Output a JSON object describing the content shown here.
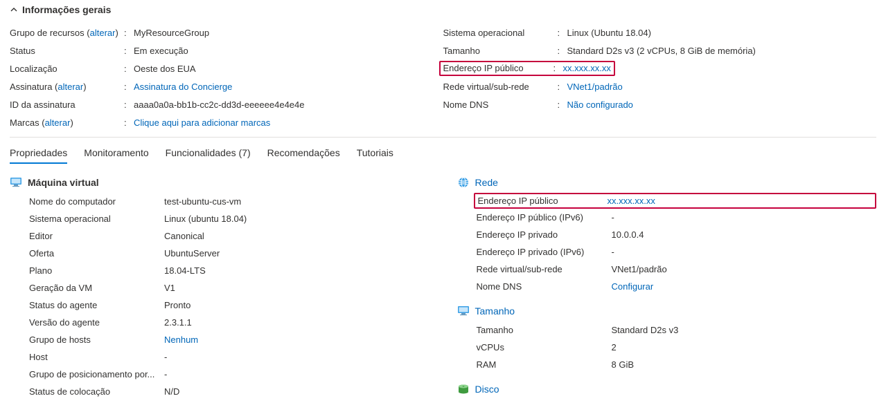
{
  "section_title": "Informações gerais",
  "change_label": "alterar",
  "left_essentials": {
    "resource_group": {
      "label": "Grupo de recursos",
      "value": "MyResourceGroup"
    },
    "status": {
      "label": "Status",
      "value": "Em execução"
    },
    "location": {
      "label": "Localização",
      "value": "Oeste dos EUA"
    },
    "subscription": {
      "label": "Assinatura",
      "value": "Assinatura do Concierge"
    },
    "subscription_id": {
      "label": "ID da assinatura",
      "value": "aaaa0a0a-bb1b-cc2c-dd3d-eeeeee4e4e4e"
    },
    "tags": {
      "label": "Marcas",
      "value": "Clique aqui para adicionar marcas"
    }
  },
  "right_essentials": {
    "os": {
      "label": "Sistema operacional",
      "value": "Linux (Ubuntu 18.04)"
    },
    "size": {
      "label": "Tamanho",
      "value": "Standard D2s v3 (2 vCPUs, 8 GiB de memória)"
    },
    "public_ip": {
      "label": "Endereço IP público",
      "value": "xx.xxx.xx.xx"
    },
    "vnet": {
      "label": "Rede virtual/sub-rede",
      "value": "VNet1/padrão"
    },
    "dns": {
      "label": "Nome DNS",
      "value": "Não configurado"
    }
  },
  "tabs": {
    "properties": "Propriedades",
    "monitoring": "Monitoramento",
    "capabilities": "Funcionalidades (7)",
    "recommendations": "Recomendações",
    "tutorials": "Tutoriais"
  },
  "vm": {
    "header": "Máquina virtual",
    "computer_name": {
      "label": "Nome do computador",
      "value": "test-ubuntu-cus-vm"
    },
    "os": {
      "label": "Sistema operacional",
      "value": "Linux (ubuntu 18.04)"
    },
    "publisher": {
      "label": "Editor",
      "value": "Canonical"
    },
    "offer": {
      "label": "Oferta",
      "value": "UbuntuServer"
    },
    "plan": {
      "label": "Plano",
      "value": "18.04-LTS"
    },
    "generation": {
      "label": "Geração da VM",
      "value": "V1"
    },
    "agent_status": {
      "label": "Status do agente",
      "value": "Pronto"
    },
    "agent_version": {
      "label": "Versão do agente",
      "value": "2.3.1.1"
    },
    "host_group": {
      "label": "Grupo de hosts",
      "value": "Nenhum"
    },
    "host": {
      "label": "Host",
      "value": "-"
    },
    "ppg": {
      "label": "Grupo de posicionamento por...",
      "value": "-"
    },
    "coloc": {
      "label": "Status de colocação",
      "value": "N/D"
    }
  },
  "network": {
    "header": "Rede",
    "public_ip": {
      "label": "Endereço IP público",
      "value": "xx.xxx.xx.xx"
    },
    "public_ipv6": {
      "label": "Endereço IP público (IPv6)",
      "value": "-"
    },
    "private_ip": {
      "label": "Endereço IP privado",
      "value": "10.0.0.4"
    },
    "private_ipv6": {
      "label": "Endereço IP privado (IPv6)",
      "value": "-"
    },
    "vnet": {
      "label": "Rede virtual/sub-rede",
      "value": "VNet1/padrão"
    },
    "dns": {
      "label": "Nome DNS",
      "value": "Configurar"
    }
  },
  "size": {
    "header": "Tamanho",
    "size": {
      "label": "Tamanho",
      "value": "Standard D2s v3"
    },
    "vcpu": {
      "label": "vCPUs",
      "value": "2"
    },
    "ram": {
      "label": "RAM",
      "value": "8 GiB"
    }
  },
  "disk": {
    "header": "Disco"
  }
}
